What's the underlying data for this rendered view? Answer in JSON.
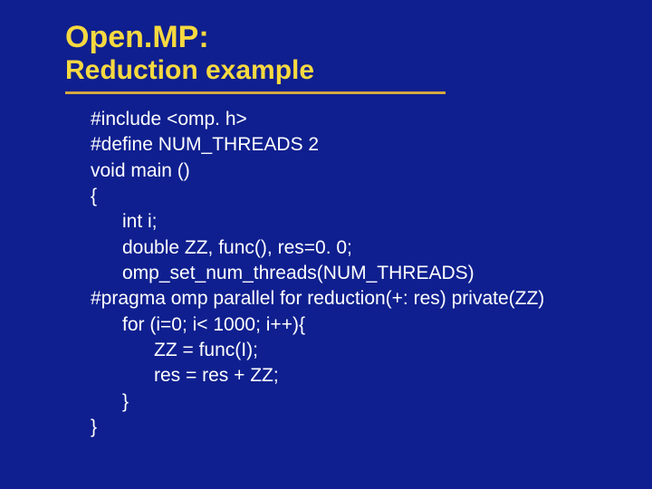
{
  "title": {
    "line1": "Open.MP:",
    "line2": "Reduction example"
  },
  "code": {
    "l1": "#include <omp. h>",
    "l2": "#define NUM_THREADS 2",
    "l3": "void main ()",
    "l4": "{",
    "l5": "      int i;",
    "l6": "      double ZZ, func(), res=0. 0;",
    "l7": "      omp_set_num_threads(NUM_THREADS)",
    "l8": "#pragma omp parallel for reduction(+: res) private(ZZ)",
    "l9": "      for (i=0; i< 1000; i++){",
    "l10": "            ZZ = func(I);",
    "l11": "            res = res + ZZ;",
    "l12": "      }",
    "l13": "}"
  }
}
